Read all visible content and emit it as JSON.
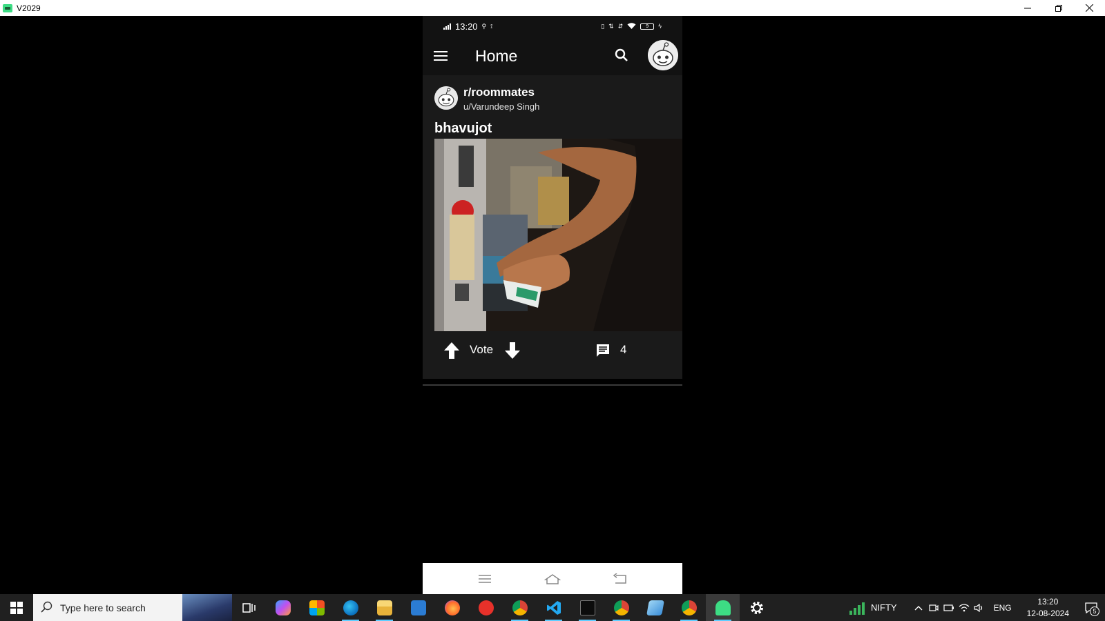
{
  "window": {
    "title": "V2029",
    "minimize_icon": "minimize-icon",
    "restore_icon": "restore-icon",
    "close_icon": "close-icon"
  },
  "status_bar": {
    "time": "13:20",
    "battery": "9"
  },
  "app_bar": {
    "title": "Home"
  },
  "post": {
    "subreddit": "r/roommates",
    "author": "u/Varundeep Singh",
    "title": "bhavujot",
    "vote_label": "Vote",
    "comment_count": "4"
  },
  "taskbar": {
    "search_placeholder": "Type here to search",
    "apps": [
      "task-view",
      "copilot",
      "microsoft-store",
      "edge",
      "file-explorer",
      "mail",
      "firefox",
      "wps-office",
      "chrome-profile",
      "vscode",
      "terminal",
      "chrome",
      "notepad",
      "chrome-alt",
      "android-emulator",
      "settings"
    ],
    "nifty_label": "NIFTY",
    "language": "ENG",
    "time": "13:20",
    "date": "12-08-2024",
    "notification_count": "5"
  },
  "colors": {
    "background": "#000000",
    "card": "#1a1a1a",
    "app_bar": "#121212",
    "taskbar": "#202020",
    "accent": "#60cdff"
  }
}
